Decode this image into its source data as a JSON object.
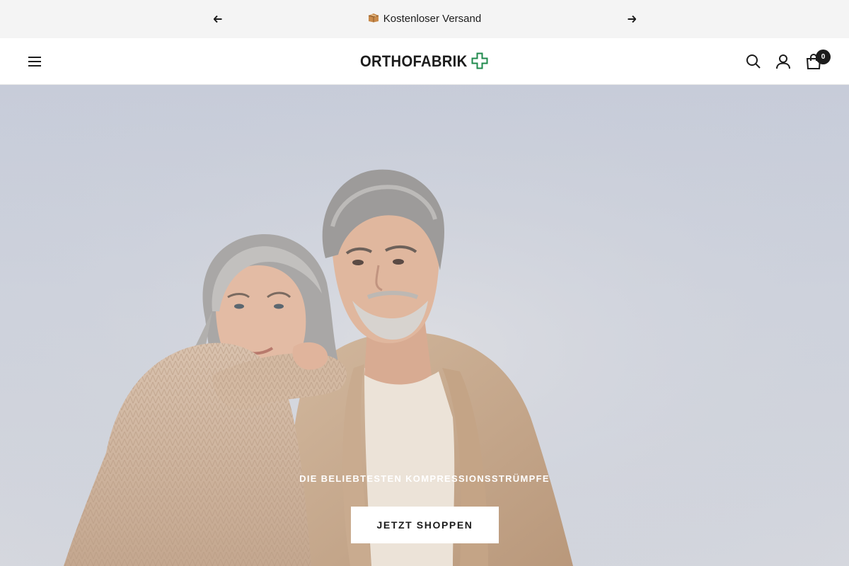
{
  "announcement": {
    "text": "Kostenloser Versand",
    "icon": "package-icon",
    "prev_icon": "arrow-left-icon",
    "next_icon": "arrow-right-icon"
  },
  "header": {
    "logo_text": "ORTHOFABRIK",
    "logo_icon": "medical-cross-icon",
    "brand_green": "#1f8a4c",
    "menu_icon": "hamburger-menu-icon",
    "search_icon": "search-icon",
    "account_icon": "user-icon",
    "cart_icon": "shopping-bag-icon",
    "cart_count": "0"
  },
  "hero": {
    "subtitle": "DIE BELIEBTESTEN KOMPRESSIONSSTRÜMPFE",
    "button_label": "JETZT SHOPPEN",
    "image_description_icon": "hero-photo"
  }
}
